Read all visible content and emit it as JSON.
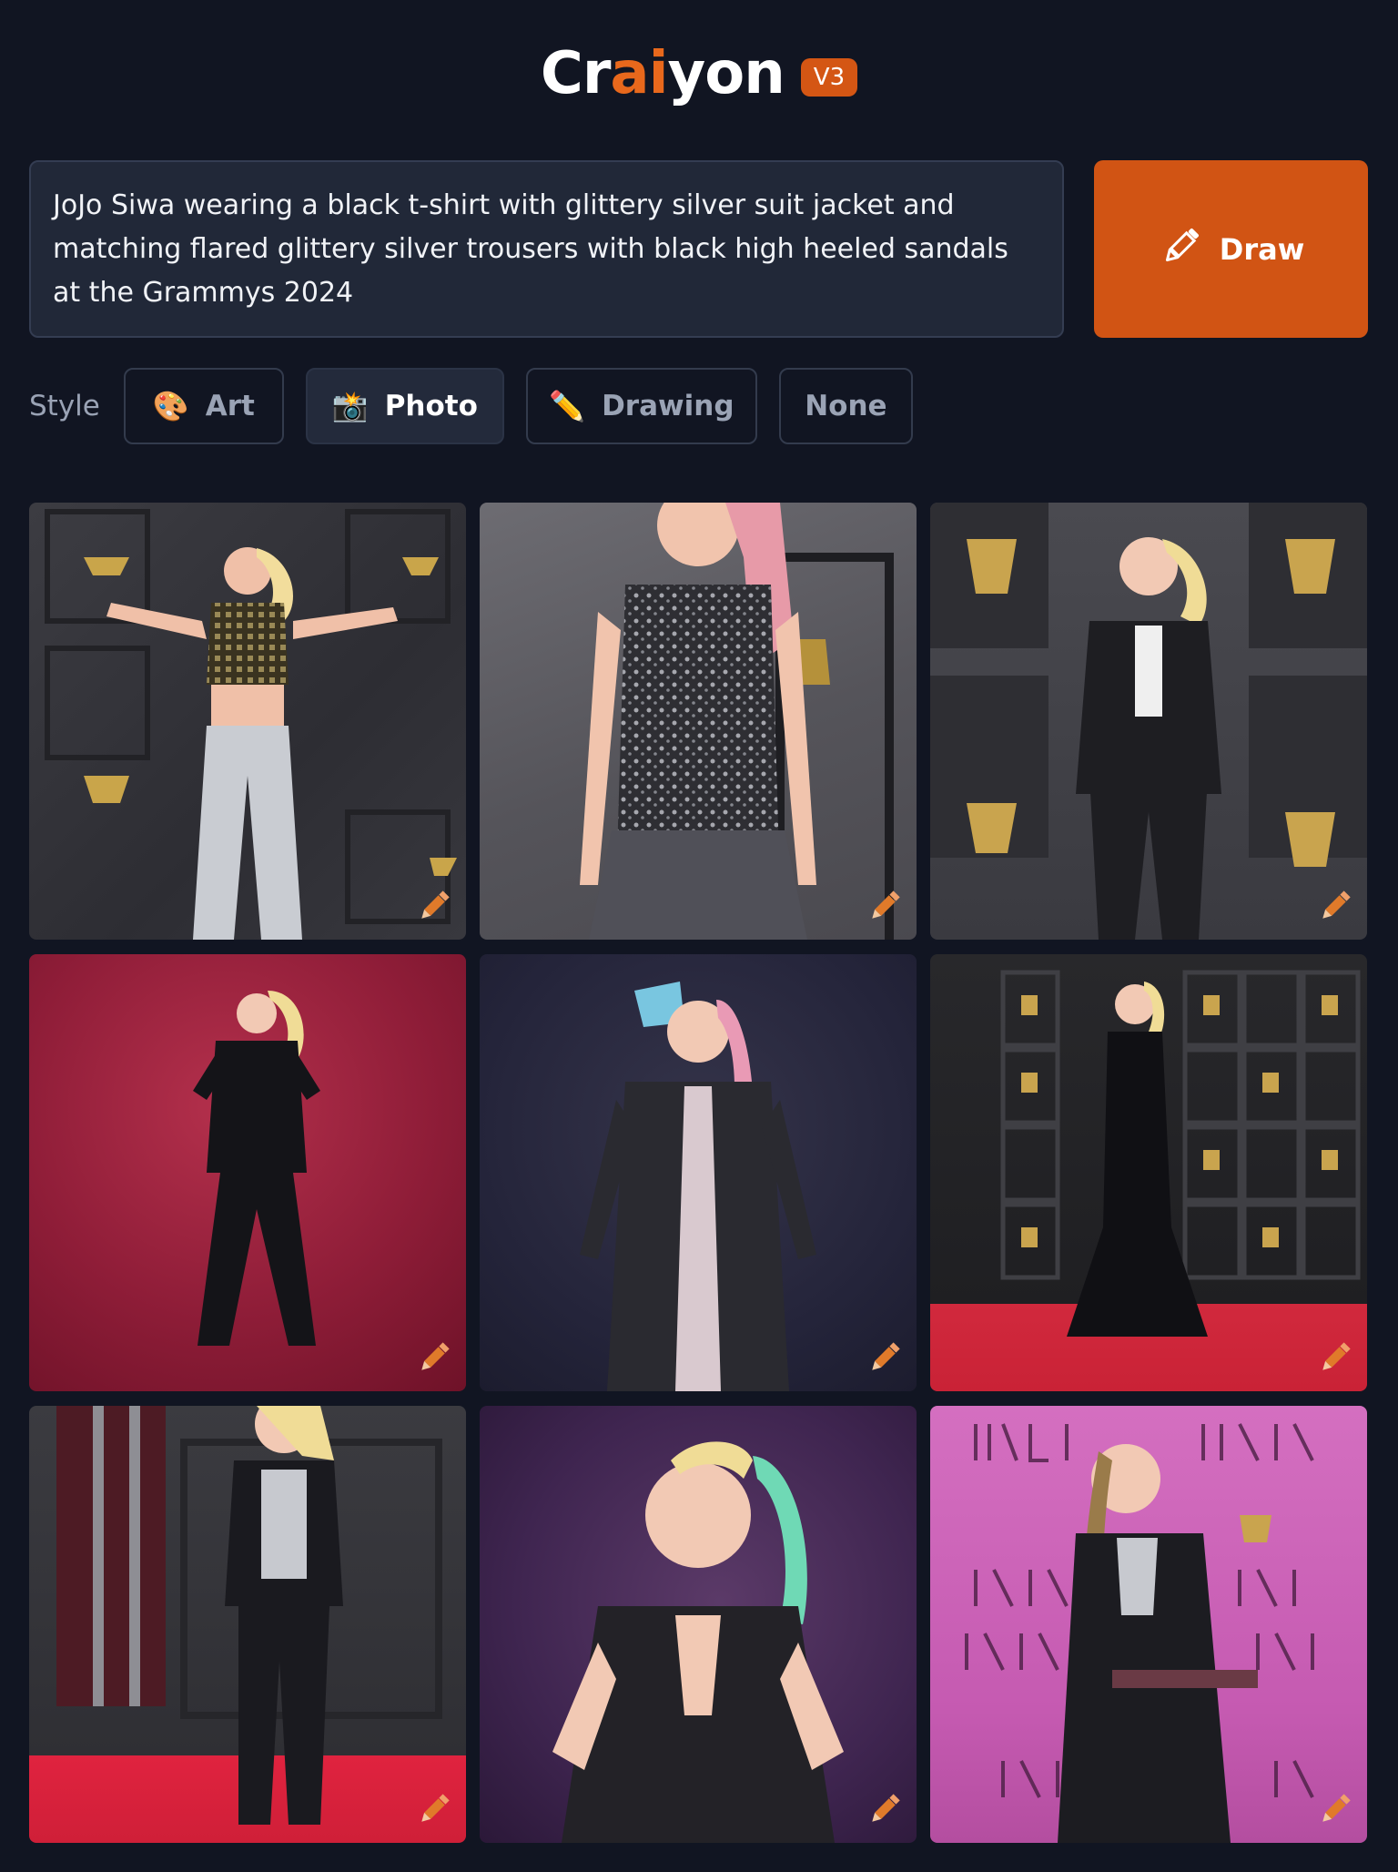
{
  "header": {
    "logo_prefix": "Cr",
    "logo_ai": "ai",
    "logo_suffix": "yon",
    "version_badge": "V3"
  },
  "prompt": {
    "text": "JoJo Siwa wearing a black t-shirt with glittery silver suit jacket and matching flared glittery silver  trousers with black high heeled sandals at the Grammys 2024"
  },
  "draw_button": {
    "label": "Draw",
    "icon": "pencil-icon"
  },
  "style_selector": {
    "label": "Style",
    "options": [
      {
        "label": "Art",
        "emoji": "🎨",
        "icon": "palette-icon"
      },
      {
        "label": "Photo",
        "emoji": "📸",
        "icon": "camera-flash-icon",
        "selected": true
      },
      {
        "label": "Drawing",
        "emoji": "✏️",
        "icon": "pencil-icon"
      },
      {
        "label": "None",
        "emoji": ""
      }
    ]
  },
  "colors": {
    "background": "#111522",
    "accent": "#d15414",
    "prompt_bg": "#212838"
  },
  "results": {
    "count": 9,
    "edit_icon": "edit-pencil-icon"
  }
}
